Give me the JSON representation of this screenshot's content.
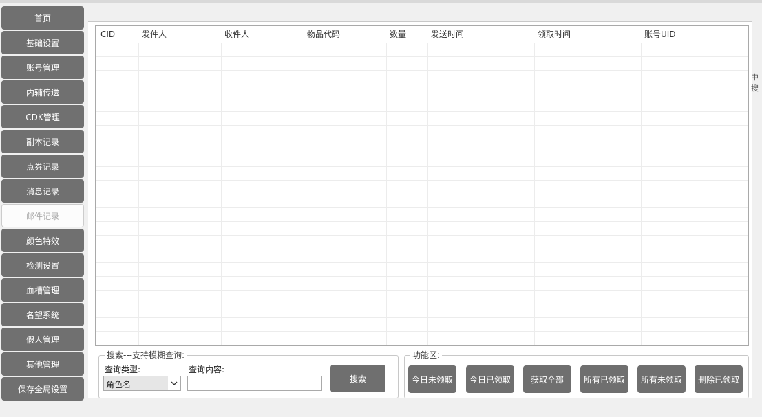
{
  "sidebar": {
    "items": [
      {
        "label": "首页",
        "active": false
      },
      {
        "label": "基础设置",
        "active": false
      },
      {
        "label": "账号管理",
        "active": false
      },
      {
        "label": "内辅传送",
        "active": false
      },
      {
        "label": "CDK管理",
        "active": false
      },
      {
        "label": "副本记录",
        "active": false
      },
      {
        "label": "点券记录",
        "active": false
      },
      {
        "label": "消息记录",
        "active": false
      },
      {
        "label": "邮件记录",
        "active": true
      },
      {
        "label": "颜色特效",
        "active": false
      },
      {
        "label": "检测设置",
        "active": false
      },
      {
        "label": "血槽管理",
        "active": false
      },
      {
        "label": "名望系统",
        "active": false
      },
      {
        "label": "假人管理",
        "active": false
      },
      {
        "label": "其他管理",
        "active": false
      },
      {
        "label": "保存全局设置",
        "active": false
      }
    ]
  },
  "table": {
    "columns": [
      "CID",
      "发件人",
      "收件人",
      "物品代码",
      "数量",
      "发送时间",
      "领取时间",
      "账号UID"
    ],
    "rows": []
  },
  "search": {
    "legend": "搜索---支持模糊查询:",
    "type_label": "查询类型:",
    "type_value": "角色名",
    "content_label": "查询内容:",
    "content_value": "",
    "search_button": "搜索"
  },
  "functions": {
    "legend": "功能区:",
    "buttons": [
      "今日未领取",
      "今日已领取",
      "获取全部",
      "所有已领取",
      "所有未领取",
      "删除已领取"
    ]
  },
  "clipped_text": "中搜"
}
